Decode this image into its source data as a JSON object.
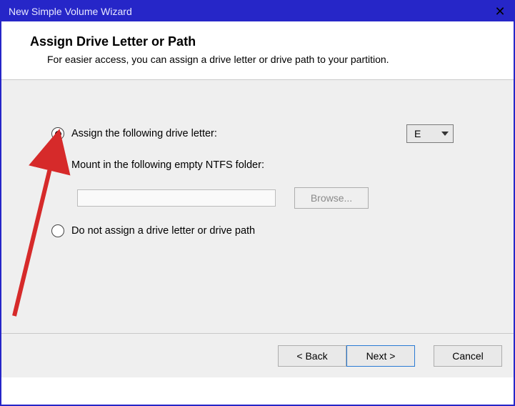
{
  "titlebar": {
    "title": "New Simple Volume Wizard"
  },
  "header": {
    "title": "Assign Drive Letter or Path",
    "description": "For easier access, you can assign a drive letter or drive path to your partition."
  },
  "options": {
    "assign_letter": {
      "label": "Assign the following drive letter:",
      "selected": true
    },
    "drive_letter": {
      "value": "E"
    },
    "mount_folder": {
      "label": "Mount in the following empty NTFS folder:",
      "selected": false
    },
    "folder_path": "",
    "browse_label": "Browse...",
    "no_assign": {
      "label": "Do not assign a drive letter or drive path",
      "selected": false
    }
  },
  "footer": {
    "back": "< Back",
    "next": "Next >",
    "cancel": "Cancel"
  }
}
